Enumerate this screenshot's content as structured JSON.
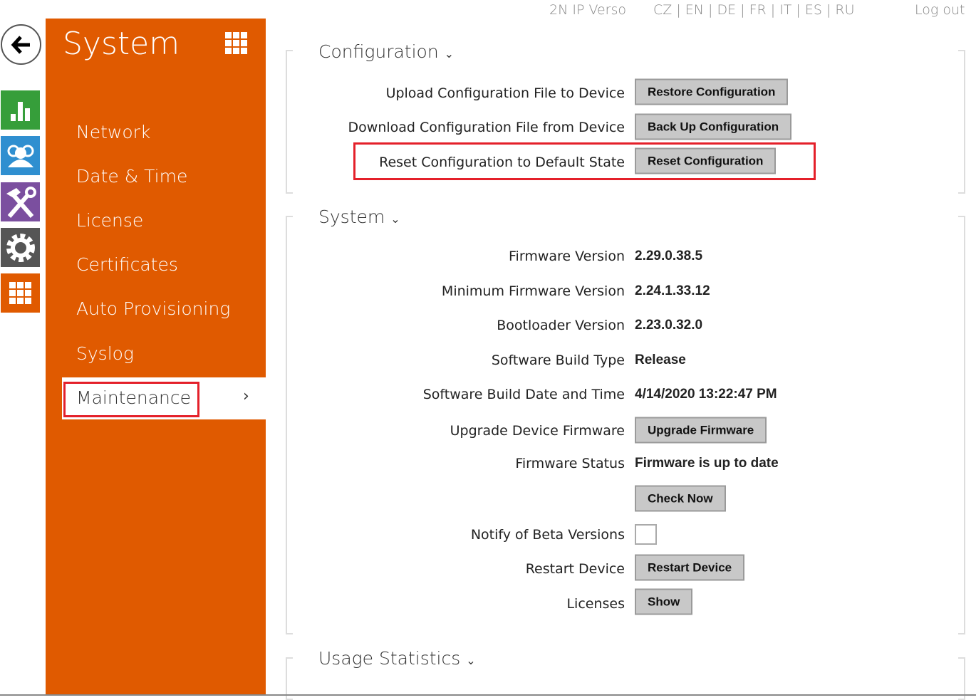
{
  "topbar": {
    "product": "2N IP Verso",
    "languages": "CZ | EN | DE | FR | IT | ES | RU",
    "logout": "Log out"
  },
  "icons": [
    "back-arrow-icon",
    "status-chart-icon",
    "directory-users-icon",
    "hardware-tools-icon",
    "services-gear-icon",
    "system-grid-icon"
  ],
  "colors": {
    "orange": "#e05a00",
    "green": "#369e3a",
    "blue": "#2f8fd0",
    "purple": "#7b4f9f",
    "gray": "#555555",
    "highlight": "#e4202a"
  },
  "sidebar": {
    "title": "System",
    "items": [
      "Network",
      "Date & Time",
      "License",
      "Certificates",
      "Auto Provisioning",
      "Syslog",
      "Maintenance"
    ],
    "active": "Maintenance"
  },
  "configuration": {
    "title": "Configuration",
    "rows": [
      {
        "label": "Upload Configuration File to Device",
        "button": "Restore Configuration"
      },
      {
        "label": "Download Configuration File from Device",
        "button": "Back Up Configuration"
      },
      {
        "label": "Reset Configuration to Default State",
        "button": "Reset Configuration"
      }
    ]
  },
  "system": {
    "title": "System",
    "firmware_version": {
      "label": "Firmware Version",
      "value": "2.29.0.38.5"
    },
    "min_firmware": {
      "label": "Minimum Firmware Version",
      "value": "2.24.1.33.12"
    },
    "bootloader": {
      "label": "Bootloader Version",
      "value": "2.23.0.32.0"
    },
    "build_type": {
      "label": "Software Build Type",
      "value": "Release"
    },
    "build_date": {
      "label": "Software Build Date and Time",
      "value": "4/14/2020 13:22:47 PM"
    },
    "upgrade": {
      "label": "Upgrade Device Firmware",
      "button": "Upgrade Firmware"
    },
    "status": {
      "label": "Firmware Status",
      "value": "Firmware is up to date"
    },
    "check_now": "Check Now",
    "beta": {
      "label": "Notify of Beta Versions",
      "checked": false
    },
    "restart": {
      "label": "Restart Device",
      "button": "Restart Device"
    },
    "licenses": {
      "label": "Licenses",
      "button": "Show"
    }
  },
  "usage": {
    "title": "Usage Statistics"
  }
}
